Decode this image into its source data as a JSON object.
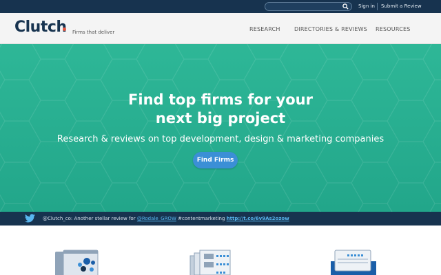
{
  "topbar": {
    "search_placeholder": "",
    "sign_in": "Sign in",
    "submit_review": "Submit a Review"
  },
  "header": {
    "logo": "Clutch",
    "tagline": "Firms that deliver",
    "nav": [
      "RESEARCH",
      "DIRECTORIES & REVIEWS",
      "RESOURCES"
    ]
  },
  "hero": {
    "title_line1": "Find top firms for your",
    "title_line2": "next big project",
    "subtitle": "Research & reviews on top development, design & marketing companies",
    "cta": "Find Firms"
  },
  "tweet": {
    "prefix": "@Clutch_co: Another stellar review for ",
    "mention": "@Rodale_GROW",
    "middle": " #contentmarketing ",
    "url": "http://t.co/6v9As2ozow"
  },
  "colors": {
    "navy": "#17334f",
    "hero_green": "#2eb797",
    "cta_blue": "#3b8fd6",
    "link_blue": "#58b6f0",
    "logo_dot": "#e5533c"
  }
}
